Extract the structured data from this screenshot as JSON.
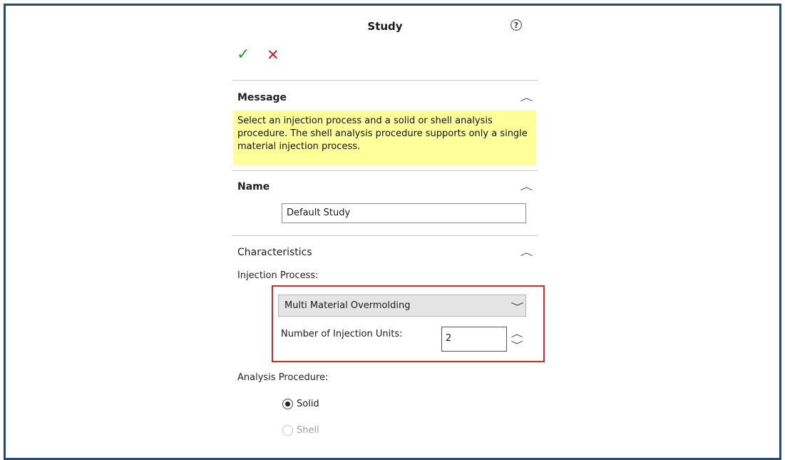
{
  "dialog": {
    "title": "Study",
    "help_glyph": "?",
    "ok_glyph": "✓",
    "cancel_glyph": "✕"
  },
  "message_section": {
    "title": "Message",
    "text": "Select an injection process and a solid or shell analysis procedure. The shell analysis procedure supports only a single material injection process."
  },
  "name_section": {
    "title": "Name",
    "value": "Default Study"
  },
  "characteristics_section": {
    "title": "Characteristics",
    "injection_process_label": "Injection Process:",
    "injection_process_value": "Multi Material Overmolding",
    "injection_units_label": "Number of Injection Units:",
    "injection_units_value": "2",
    "analysis_procedure_label": "Analysis Procedure:",
    "analysis_options": [
      {
        "label": "Solid",
        "selected": true,
        "enabled": true
      },
      {
        "label": "Shell",
        "selected": false,
        "enabled": false
      }
    ]
  },
  "icons": {
    "collapse": "chevron-up-icon",
    "dropdown": "chevron-down-icon",
    "help": "help-icon",
    "ok": "check-icon",
    "cancel": "close-icon"
  },
  "colors": {
    "frame_border": "#1f4e79",
    "message_bg": "#ffff99",
    "highlight_border": "#dd2222",
    "ok": "#2f9a2f",
    "cancel": "#d11f1f"
  }
}
